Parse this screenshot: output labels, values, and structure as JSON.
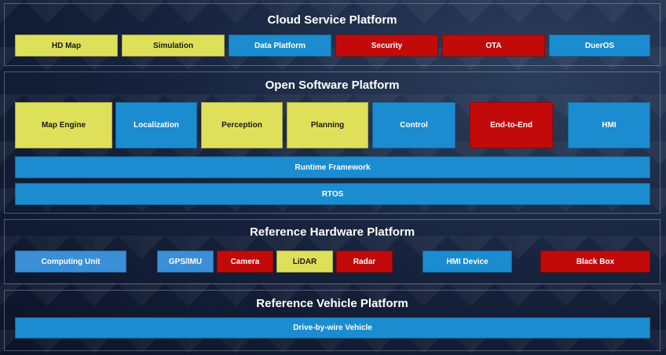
{
  "cloud": {
    "title": "Cloud Service Platform",
    "items": [
      "HD Map",
      "Simulation",
      "Data Platform",
      "Security",
      "OTA",
      "DuerOS"
    ]
  },
  "software": {
    "title": "Open Software Platform",
    "modules": [
      "Map Engine",
      "Localization",
      "Perception",
      "Planning",
      "Control",
      "End-to-End",
      "HMI"
    ],
    "runtime": "Runtime Framework",
    "rtos": "RTOS"
  },
  "hardware": {
    "title": "Reference Hardware Platform",
    "items": [
      "Computing Unit",
      "GPS/IMU",
      "Camera",
      "LiDAR",
      "Radar",
      "HMI Device",
      "Black Box"
    ]
  },
  "vehicle": {
    "title": "Reference Vehicle Platform",
    "item": "Drive-by-wire Vehicle"
  },
  "colors": {
    "yellow": "#dfe05a",
    "blue": "#1b8ccf",
    "red": "#c20a0a"
  }
}
